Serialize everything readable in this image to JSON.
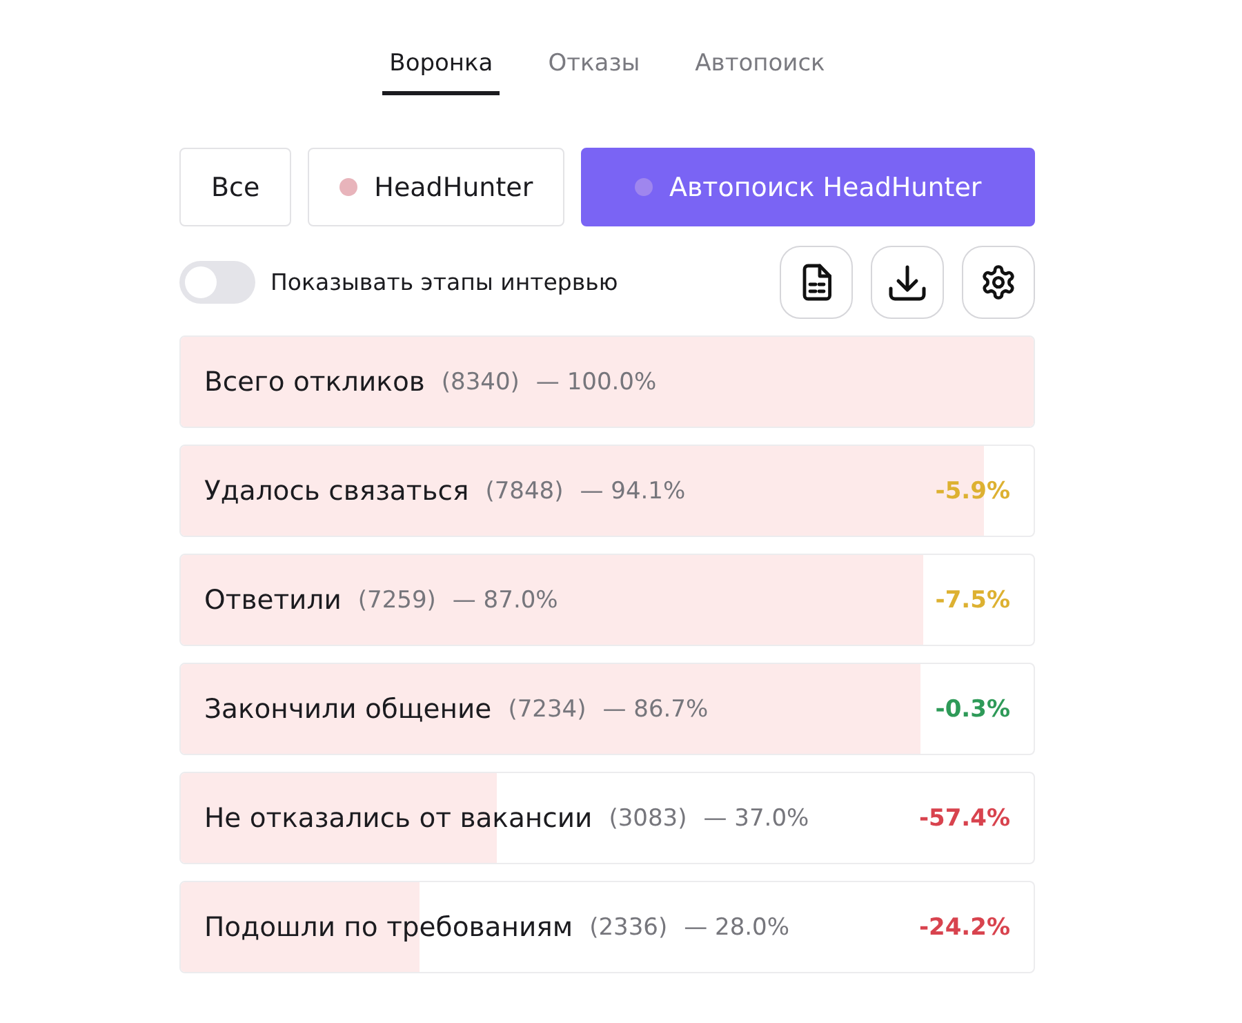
{
  "tabs": [
    {
      "label": "Воронка",
      "selected": true
    },
    {
      "label": "Отказы",
      "selected": false
    },
    {
      "label": "Автопоиск",
      "selected": false
    }
  ],
  "sources": [
    {
      "label": "Все",
      "selected": false
    },
    {
      "label": "HeadHunter",
      "selected": false,
      "color": "#e8b4bb"
    },
    {
      "label": "Автопоиск HeadHunter",
      "selected": true,
      "color": "#9f86ee"
    }
  ],
  "interview_stages_toggle": {
    "label": "Показывать этапы интервью",
    "on": false
  },
  "funnel": [
    {
      "label": "Всего откликов",
      "count": "(8340)",
      "share": "— 100.0%",
      "level": 1.0
    },
    {
      "label": "Удалось связаться",
      "count": "(7848)",
      "share": "— 94.1%",
      "level": 0.941,
      "delta": {
        "text": "-5.9%",
        "color": "#ddb131"
      }
    },
    {
      "label": "Ответили",
      "count": "(7259)",
      "share": "— 87.0%",
      "level": 0.87,
      "delta": {
        "text": "-7.5%",
        "color": "#ddb131"
      }
    },
    {
      "label": "Закончили общение",
      "count": "(7234)",
      "share": "— 86.7%",
      "level": 0.867,
      "delta": {
        "text": "-0.3%",
        "color": "#2e9a58"
      }
    },
    {
      "label": "Не отказались от вакансии",
      "count": "(3083)",
      "share": "— 37.0%",
      "level": 0.37,
      "delta": {
        "text": "-57.4%",
        "color": "#d8434e"
      }
    },
    {
      "label": "Подошли по требованиям",
      "count": "(2336)",
      "share": "— 28.0%",
      "level": 0.28,
      "delta": {
        "text": "-24.2%",
        "color": "#d8434e"
      }
    }
  ]
}
